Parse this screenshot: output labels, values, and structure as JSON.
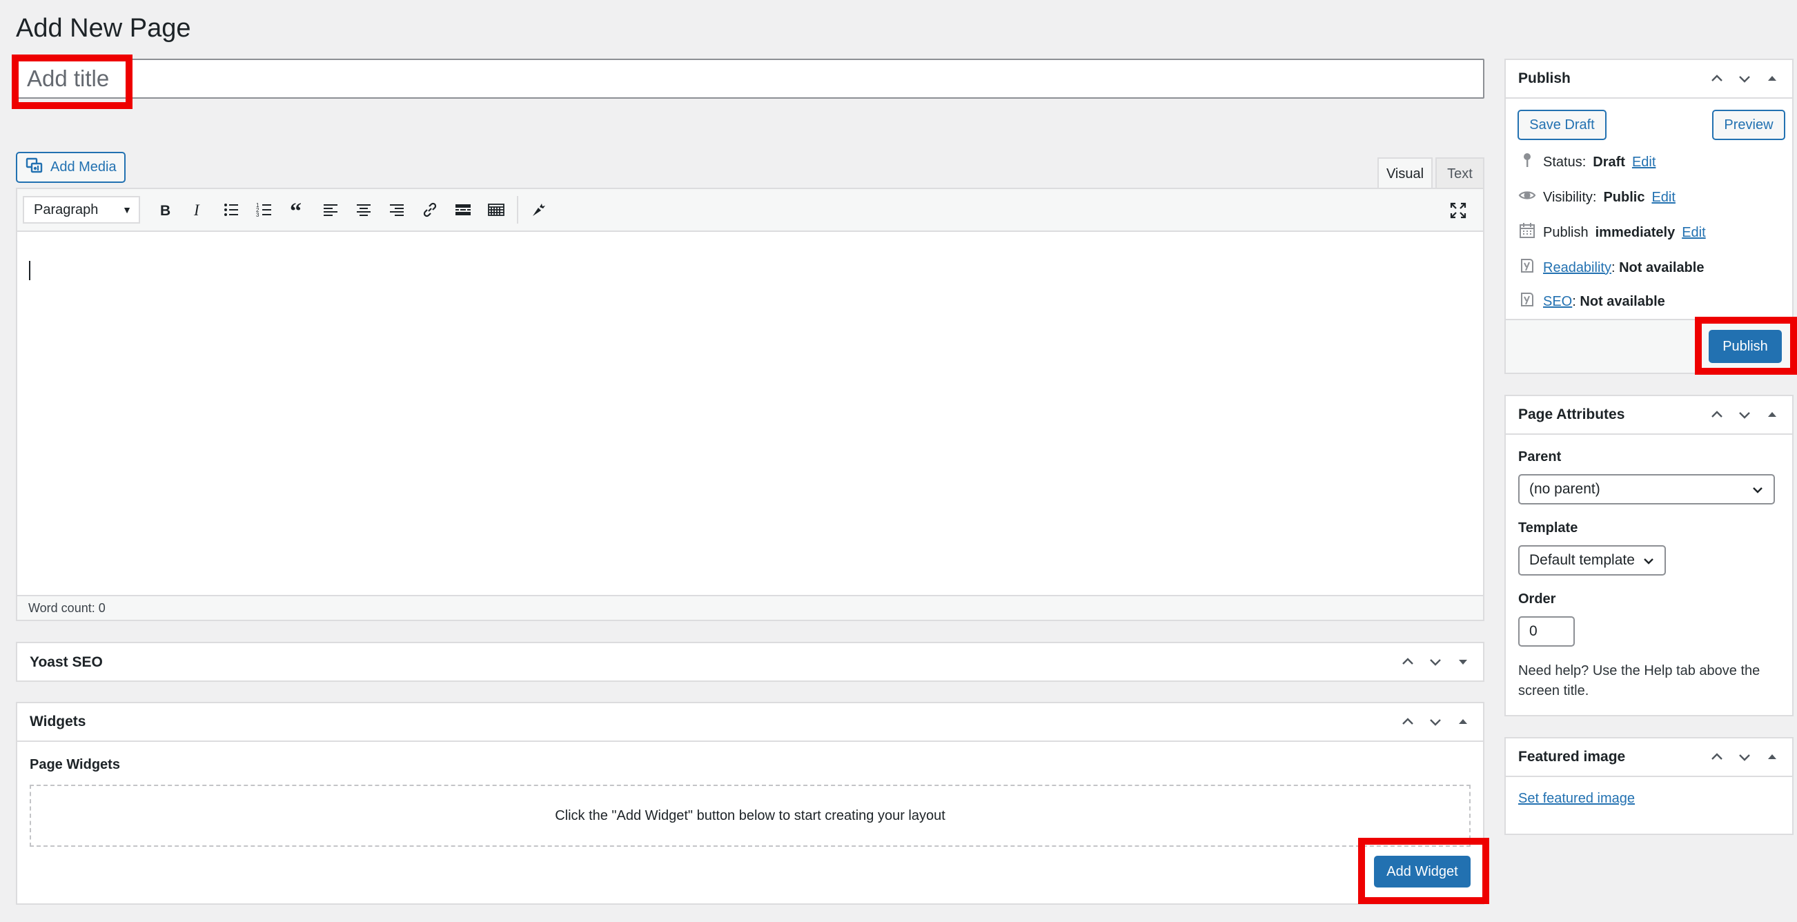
{
  "page": {
    "title": "Add New Page"
  },
  "title_field": {
    "placeholder": "Add title"
  },
  "editor": {
    "add_media_label": "Add Media",
    "tabs": {
      "visual": "Visual",
      "text": "Text"
    },
    "format_select": "Paragraph",
    "toolbar_icons": [
      "bold-icon",
      "italic-icon",
      "bulleted-list-icon",
      "numbered-list-icon",
      "blockquote-icon",
      "align-left-icon",
      "align-center-icon",
      "align-right-icon",
      "insert-link-icon",
      "read-more-icon",
      "toolbar-toggle-icon",
      "carrot-icon",
      "fullscreen-icon"
    ],
    "word_count": "Word count: 0"
  },
  "yoast_box": {
    "title": "Yoast SEO"
  },
  "widgets_box": {
    "title": "Widgets",
    "section_label": "Page Widgets",
    "empty_message": "Click the \"Add Widget\" button below to start creating your layout",
    "add_widget_label": "Add Widget"
  },
  "publish_box": {
    "title": "Publish",
    "save_draft_label": "Save Draft",
    "preview_label": "Preview",
    "status": {
      "label": "Status:",
      "value": "Draft",
      "edit": "Edit"
    },
    "visibility": {
      "label": "Visibility:",
      "value": "Public",
      "edit": "Edit"
    },
    "schedule": {
      "label": "Publish",
      "value": "immediately",
      "edit": "Edit"
    },
    "readability": {
      "link": "Readability",
      "value": "Not available"
    },
    "seo": {
      "link": "SEO",
      "value": "Not available"
    },
    "publish_label": "Publish"
  },
  "page_attributes": {
    "title": "Page Attributes",
    "parent_label": "Parent",
    "parent_value": "(no parent)",
    "template_label": "Template",
    "template_value": "Default template",
    "order_label": "Order",
    "order_value": "0",
    "help_text": "Need help? Use the Help tab above the screen title."
  },
  "featured_image": {
    "title": "Featured image",
    "set_link": "Set featured image"
  },
  "colors": {
    "accent": "#2271b1",
    "highlight": "#ee0000",
    "background": "#f0f0f1"
  }
}
